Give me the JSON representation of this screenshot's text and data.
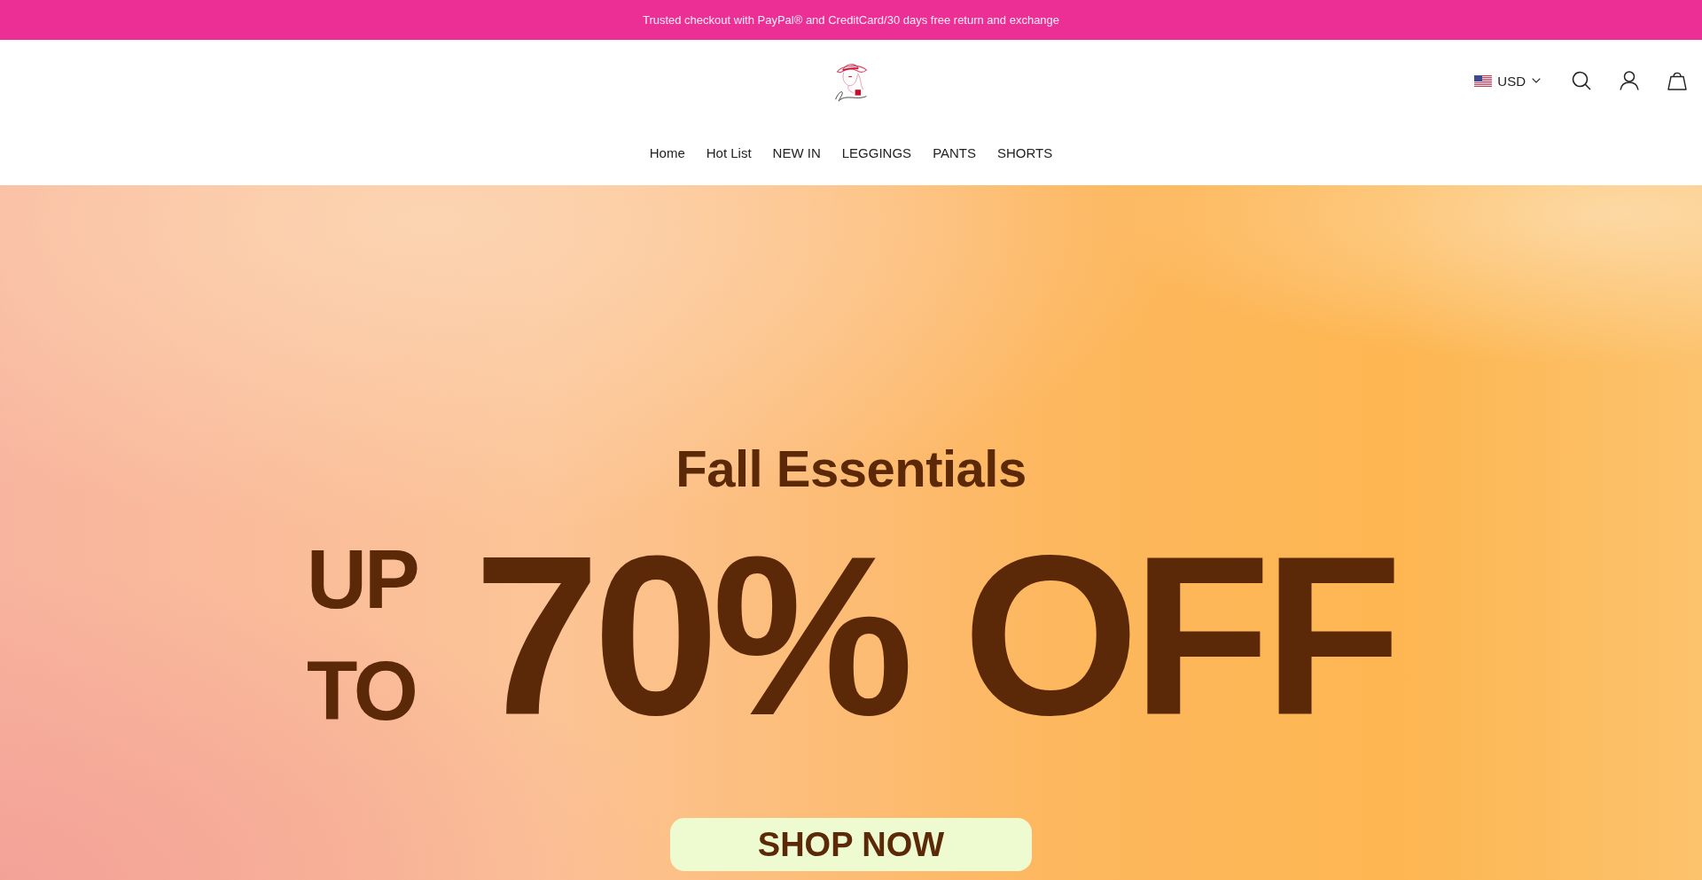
{
  "announcement": "Trusted checkout with PayPal® and CreditCard/30 days free return and exchange",
  "header": {
    "currency": "USD"
  },
  "nav": [
    "Home",
    "Hot List",
    "NEW IN",
    "LEGGINGS",
    "PANTS",
    "SHORTS"
  ],
  "hero": {
    "eyebrow": "Fall Essentials",
    "prefix_lines": [
      "UP",
      "TO"
    ],
    "headline": "70% OFF",
    "button": "SHOP NOW"
  }
}
